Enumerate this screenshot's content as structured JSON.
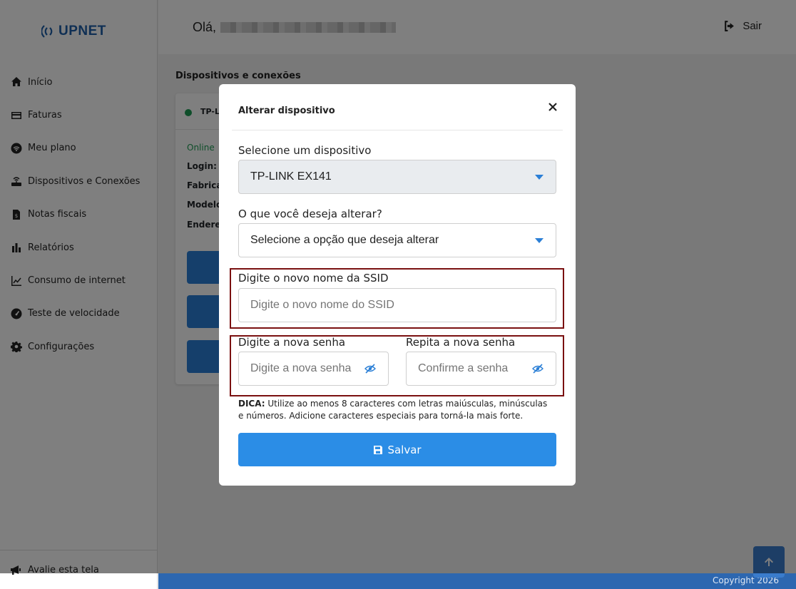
{
  "brand": {
    "name": "UPNET",
    "color": "#1e5fa8"
  },
  "sidebar": {
    "items": [
      {
        "label": "Início",
        "icon": "home-icon"
      },
      {
        "label": "Faturas",
        "icon": "credit-card-icon"
      },
      {
        "label": "Meu plano",
        "icon": "wifi-icon"
      },
      {
        "label": "Dispositivos e Conexões",
        "icon": "router-icon"
      },
      {
        "label": "Notas fiscais",
        "icon": "invoice-icon"
      },
      {
        "label": "Relatórios",
        "icon": "bar-chart-icon"
      },
      {
        "label": "Consumo de internet",
        "icon": "line-chart-icon"
      },
      {
        "label": "Teste de velocidade",
        "icon": "speedometer-icon"
      },
      {
        "label": "Configurações",
        "icon": "gear-icon"
      }
    ],
    "footer": {
      "label": "Avalie esta tela",
      "icon": "megaphone-icon"
    }
  },
  "header": {
    "greeting": "Olá,",
    "logout_label": "Sair"
  },
  "main": {
    "title": "Dispositivos e conexões",
    "device_card": {
      "name": "TP-L",
      "status": "Online",
      "labels": [
        "Login:",
        "Fabrica",
        "Modelo",
        "Endere"
      ]
    }
  },
  "modal": {
    "title": "Alterar dispositivo",
    "device_select": {
      "label": "Selecione um dispositivo",
      "value": "TP-LINK EX141"
    },
    "option_select": {
      "label": "O que você deseja alterar?",
      "value": "Selecione a opção que deseja alterar"
    },
    "ssid": {
      "label": "Digite o novo nome da SSID",
      "placeholder": "Digite o novo nome do SSID"
    },
    "password": {
      "label": "Digite a nova senha",
      "placeholder": "Digite a nova senha"
    },
    "confirm": {
      "label": "Repita a nova senha",
      "placeholder": "Confirme a senha"
    },
    "tip": {
      "prefix": "DICA:",
      "text": " Utilize ao menos 8 caracteres com letras maiúsculas, minúsculas e números. Adicione caracteres especiais para torná-la mais forte."
    },
    "save_label": "Salvar"
  },
  "footer": {
    "copyright": "Copyright 2026"
  },
  "colors": {
    "primary": "#2b8de6",
    "online": "#1f9d55",
    "highlight": "#7a1010"
  }
}
